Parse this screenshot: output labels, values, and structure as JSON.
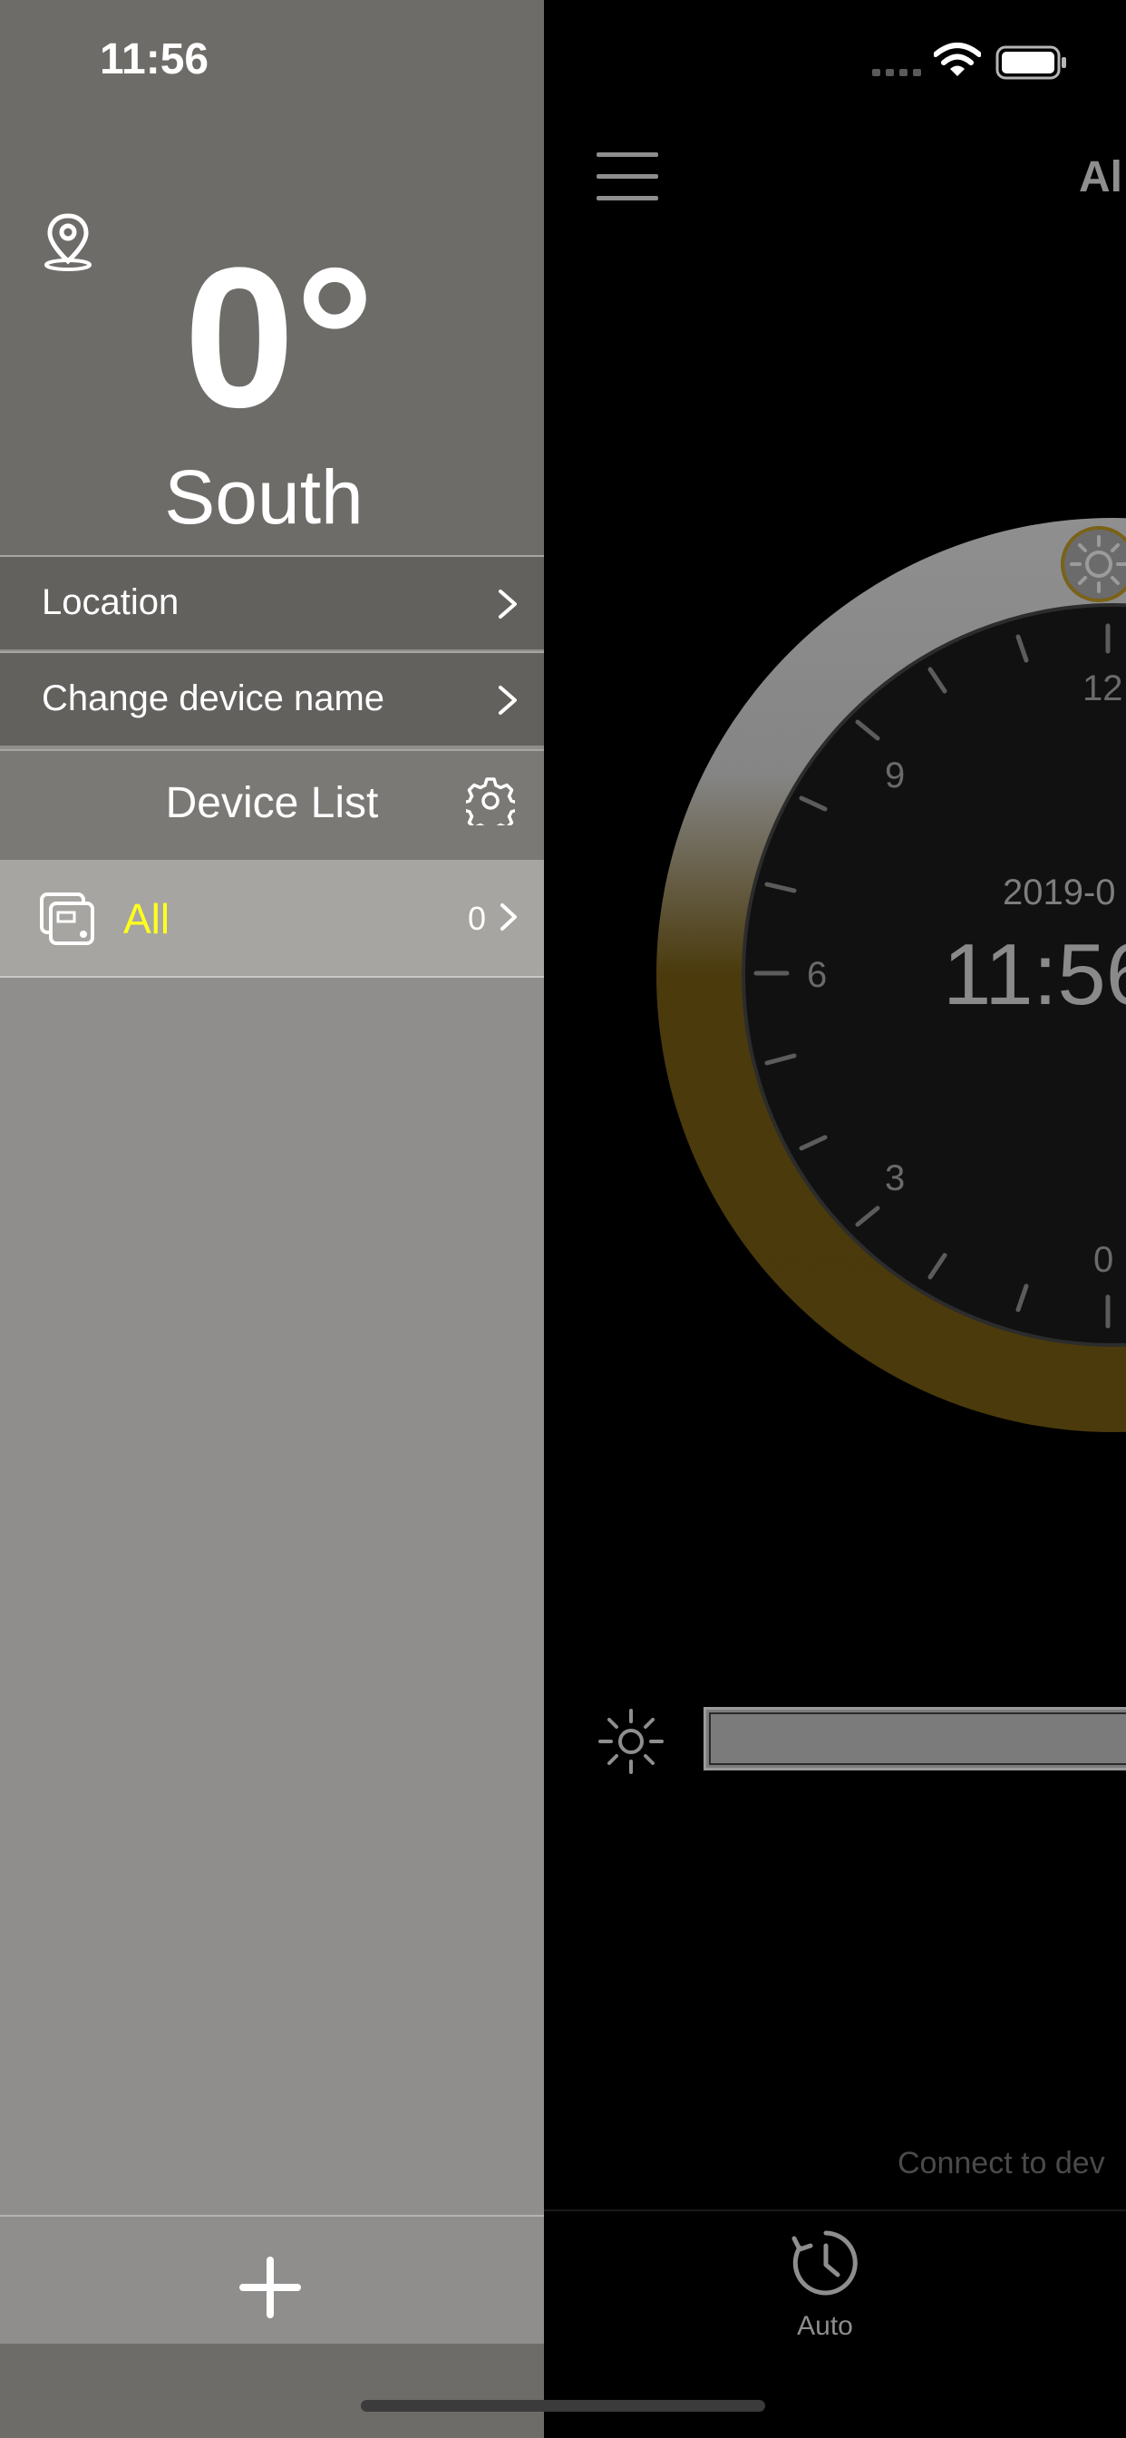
{
  "status_bar": {
    "time": "11:56"
  },
  "drawer": {
    "heading": {
      "angle": "0°",
      "direction": "South"
    },
    "menu": [
      {
        "label": "Location"
      },
      {
        "label": "Change device name"
      }
    ],
    "device_list": {
      "title": "Device List",
      "items": [
        {
          "name": "All",
          "count": "0"
        }
      ]
    }
  },
  "main": {
    "title": "Al",
    "dial": {
      "date": "2019-0",
      "time": "11:56",
      "hour_labels": [
        "12",
        "9",
        "6",
        "3",
        "0"
      ]
    },
    "connect_hint": "Connect to dev",
    "tabs": [
      {
        "label": "Auto",
        "icon": "clock-icon"
      }
    ]
  },
  "colors": {
    "device_name": "#FFFF1E",
    "drawer_top": "#6D6C68",
    "ring_gold": "#4D3A0A",
    "ring_gray": "#8C8C8C"
  }
}
